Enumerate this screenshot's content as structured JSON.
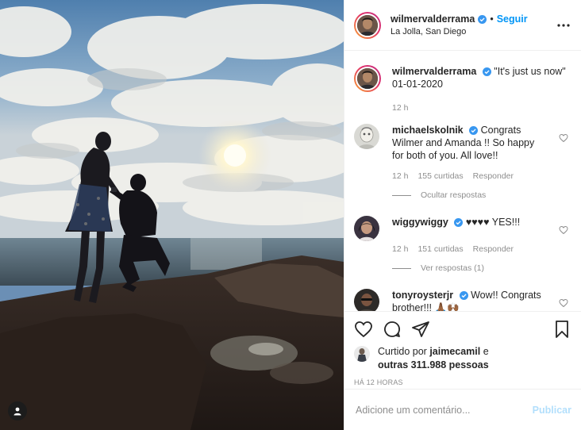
{
  "post": {
    "author": "wilmervalderrama",
    "follow_label": "Seguir",
    "separator": "•",
    "location": "La Jolla, San Diego",
    "more_icon": "more-horizontal-icon"
  },
  "caption": {
    "user": "wilmervalderrama",
    "text": "\"It's just us now\" 01-01-2020",
    "time": "12 h"
  },
  "comments": [
    {
      "user": "michaelskolnik",
      "text": "Congrats Wilmer and Amanda !! So happy for both of you. All love!!",
      "time": "12 h",
      "likes": "155 curtidas",
      "reply_label": "Responder",
      "replies_label": "Ocultar respostas"
    },
    {
      "user": "wiggywiggy",
      "text": "♥♥♥♥ YES!!!",
      "time": "12 h",
      "likes": "151 curtidas",
      "reply_label": "Responder",
      "replies_label": "Ver respostas (1)"
    },
    {
      "user": "tonyroysterjr",
      "text": "Wow!! Congrats brother!!! 🙏🏾🙌🏾"
    }
  ],
  "liked_by": {
    "prefix": "Curtido por ",
    "user": "jaimecamil",
    "conjunction": " e",
    "others": "outras 311.988 pessoas"
  },
  "timestamp": "HÁ 12 HORAS",
  "composer": {
    "placeholder": "Adicione um comentário...",
    "publish_label": "Publicar"
  },
  "colors": {
    "link_blue": "#0095f6",
    "publish_disabled": "#b2dffc",
    "verified_blue": "#3897f0",
    "muted": "#8e8e8e"
  }
}
